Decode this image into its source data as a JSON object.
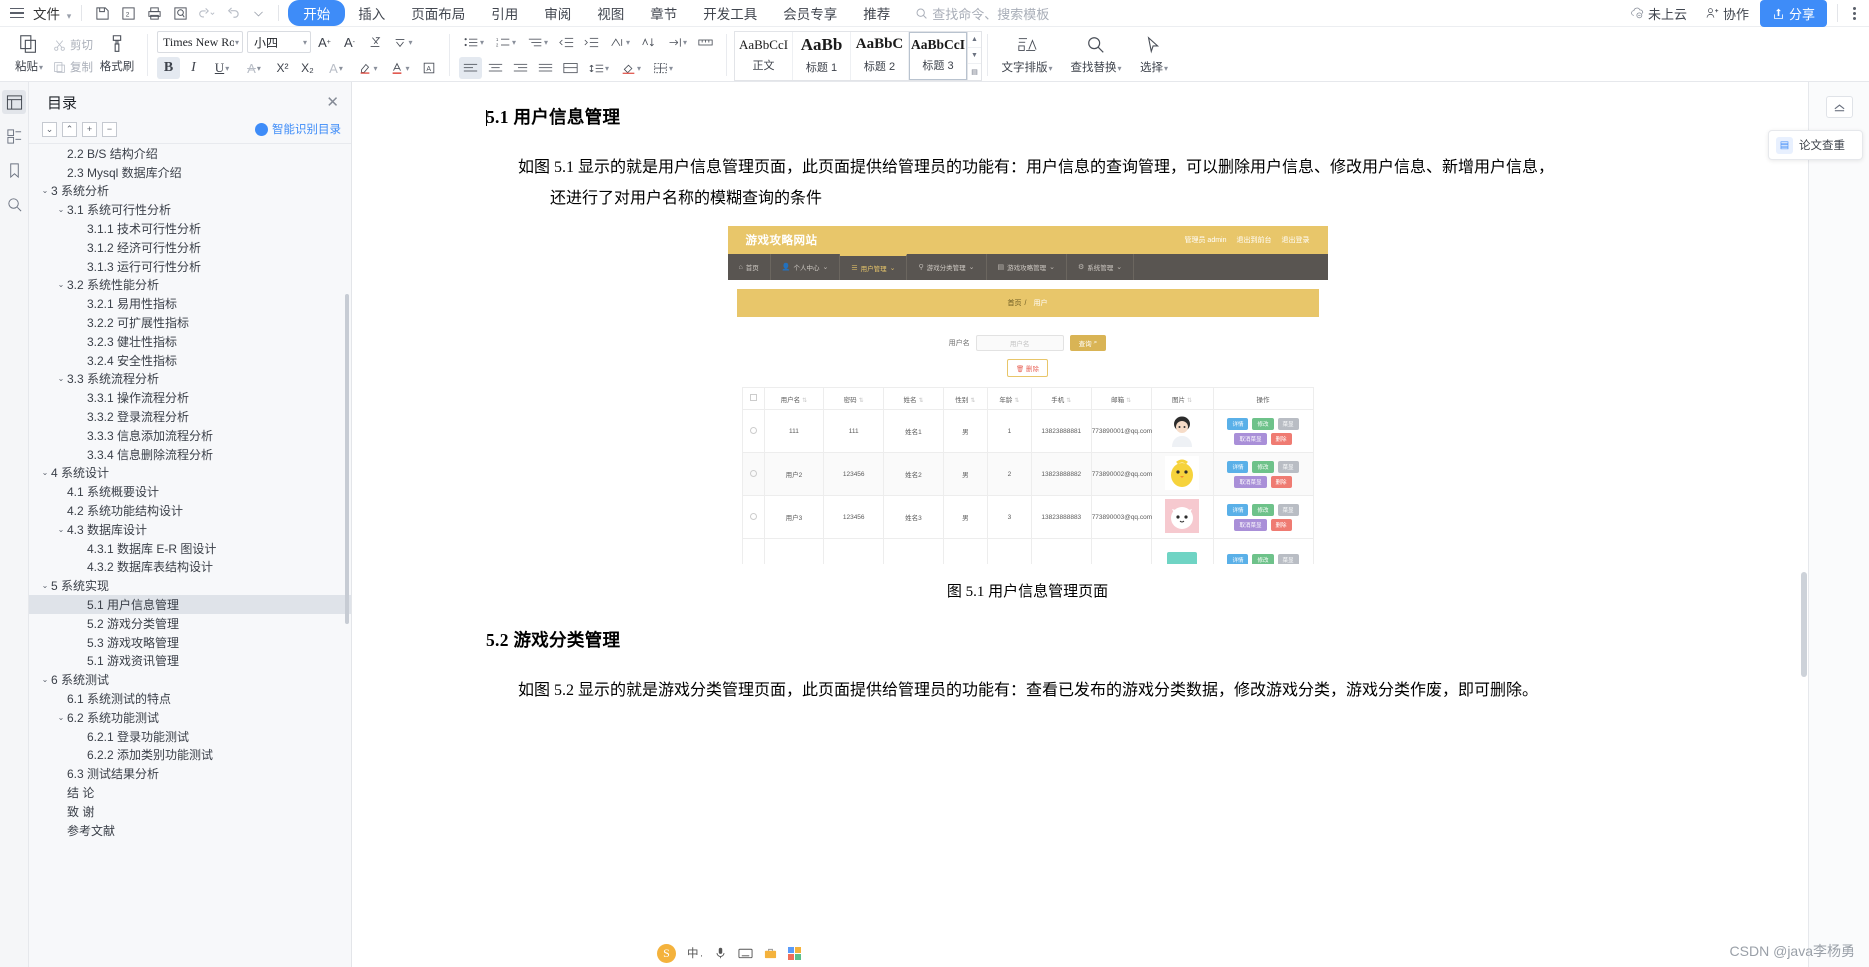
{
  "menubar": {
    "file_label": "文件",
    "quick_icons": [
      "save-icon",
      "save-as-icon",
      "print-icon",
      "print-preview-icon",
      "undo-icon",
      "redo-icon",
      "customize-icon"
    ],
    "tabs": [
      {
        "label": "开始",
        "active": true
      },
      {
        "label": "插入",
        "active": false
      },
      {
        "label": "页面布局",
        "active": false
      },
      {
        "label": "引用",
        "active": false
      },
      {
        "label": "审阅",
        "active": false
      },
      {
        "label": "视图",
        "active": false
      },
      {
        "label": "章节",
        "active": false
      },
      {
        "label": "开发工具",
        "active": false
      },
      {
        "label": "会员专享",
        "active": false
      },
      {
        "label": "推荐",
        "active": false
      }
    ],
    "search_placeholder": "查找命令、搜索模板",
    "cloud_label": "未上云",
    "collab_label": "协作",
    "share_label": "分享"
  },
  "ribbon": {
    "paste_label": "粘贴",
    "cut_label": "剪切",
    "copy_label": "复制",
    "format_painter_label": "格式刷",
    "font_name": "Times New Roma",
    "font_size": "小四",
    "grow_font": "A",
    "shrink_font": "A",
    "bold": "B",
    "italic": "I",
    "underline": "U",
    "strikethrough": "A",
    "superscript": "X²",
    "subscript": "X₂",
    "styles": [
      {
        "sample": "AaBbCcI",
        "name": "正文",
        "selected": false
      },
      {
        "sample": "AaBb",
        "name": "标题 1",
        "selected": false
      },
      {
        "sample": "AaBbC",
        "name": "标题 2",
        "selected": false
      },
      {
        "sample": "AaBbCcI",
        "name": "标题 3",
        "selected": true
      }
    ],
    "text_layout_label": "文字排版",
    "find_replace_label": "查找替换",
    "select_label": "选择"
  },
  "outline": {
    "title": "目录",
    "smart_label": "智能识别目录",
    "items": [
      {
        "label": "2.2 B/S 结构介绍",
        "level": 2,
        "arrow": "",
        "selected": false
      },
      {
        "label": "2.3 Mysql 数据库介绍",
        "level": 2,
        "arrow": "",
        "selected": false
      },
      {
        "label": "3  系统分析",
        "level": 1,
        "arrow": "v",
        "selected": false
      },
      {
        "label": "3.1  系统可行性分析",
        "level": 2,
        "arrow": "v",
        "selected": false
      },
      {
        "label": "3.1.1  技术可行性分析",
        "level": 3,
        "arrow": "",
        "selected": false
      },
      {
        "label": "3.1.2  经济可行性分析",
        "level": 3,
        "arrow": "",
        "selected": false
      },
      {
        "label": "3.1.3  运行可行性分析",
        "level": 3,
        "arrow": "",
        "selected": false
      },
      {
        "label": "3.2  系统性能分析",
        "level": 2,
        "arrow": "v",
        "selected": false
      },
      {
        "label": "3.2.1  易用性指标",
        "level": 3,
        "arrow": "",
        "selected": false
      },
      {
        "label": "3.2.2  可扩展性指标",
        "level": 3,
        "arrow": "",
        "selected": false
      },
      {
        "label": "3.2.3  健壮性指标",
        "level": 3,
        "arrow": "",
        "selected": false
      },
      {
        "label": "3.2.4  安全性指标",
        "level": 3,
        "arrow": "",
        "selected": false
      },
      {
        "label": "3.3  系统流程分析",
        "level": 2,
        "arrow": "v",
        "selected": false
      },
      {
        "label": "3.3.1  操作流程分析",
        "level": 3,
        "arrow": "",
        "selected": false
      },
      {
        "label": "3.3.2  登录流程分析",
        "level": 3,
        "arrow": "",
        "selected": false
      },
      {
        "label": "3.3.3  信息添加流程分析",
        "level": 3,
        "arrow": "",
        "selected": false
      },
      {
        "label": "3.3.4  信息删除流程分析",
        "level": 3,
        "arrow": "",
        "selected": false
      },
      {
        "label": "4  系统设计",
        "level": 1,
        "arrow": "v",
        "selected": false
      },
      {
        "label": "4.1  系统概要设计",
        "level": 2,
        "arrow": "",
        "selected": false
      },
      {
        "label": "4.2  系统功能结构设计",
        "level": 2,
        "arrow": "",
        "selected": false
      },
      {
        "label": "4.3  数据库设计",
        "level": 2,
        "arrow": "v",
        "selected": false
      },
      {
        "label": "4.3.1  数据库 E-R 图设计",
        "level": 3,
        "arrow": "",
        "selected": false
      },
      {
        "label": "4.3.2  数据库表结构设计",
        "level": 3,
        "arrow": "",
        "selected": false
      },
      {
        "label": "5  系统实现",
        "level": 1,
        "arrow": "v",
        "selected": false
      },
      {
        "label": "5.1 用户信息管理",
        "level": 3,
        "arrow": "",
        "selected": true
      },
      {
        "label": "5.2  游戏分类管理",
        "level": 3,
        "arrow": "",
        "selected": false
      },
      {
        "label": "5.3 游戏攻略管理",
        "level": 3,
        "arrow": "",
        "selected": false
      },
      {
        "label": "5.1 游戏资讯管理",
        "level": 3,
        "arrow": "",
        "selected": false
      },
      {
        "label": "6  系统测试",
        "level": 1,
        "arrow": "v",
        "selected": false
      },
      {
        "label": "6.1  系统测试的特点",
        "level": 2,
        "arrow": "",
        "selected": false
      },
      {
        "label": "6.2  系统功能测试",
        "level": 2,
        "arrow": "v",
        "selected": false
      },
      {
        "label": "6.2.1  登录功能测试",
        "level": 3,
        "arrow": "",
        "selected": false
      },
      {
        "label": "6.2.2  添加类别功能测试",
        "level": 3,
        "arrow": "",
        "selected": false
      },
      {
        "label": "6.3  测试结果分析",
        "level": 2,
        "arrow": "",
        "selected": false
      },
      {
        "label": "结   论",
        "level": 2,
        "arrow": "",
        "selected": false
      },
      {
        "label": "致   谢",
        "level": 2,
        "arrow": "",
        "selected": false
      },
      {
        "label": "参考文献",
        "level": 2,
        "arrow": "",
        "selected": false
      }
    ]
  },
  "document": {
    "heading1": "5.1 用户信息管理",
    "para1": "如图 5.1 显示的就是用户信息管理页面，此页面提供给管理员的功能有：用户信息的查询管理，可以删除用户信息、修改用户信息、新增用户信息，",
    "para1b": "还进行了对用户名称的模糊查询的条件",
    "figure_caption": "图 5.1  用户信息管理页面",
    "heading2": "5.2  游戏分类管理",
    "para2": "如图 5.2 显示的就是游戏分类管理页面，此页面提供给管理员的功能有：查看已发布的游戏分类数据，修改游戏分类，游戏分类作废，即可删除。"
  },
  "embedded_app": {
    "brand": "游戏攻略网站",
    "admin_text": "管理员 admin",
    "logout_admin": "退出到前台",
    "logout": "退出登录",
    "nav": [
      {
        "label": "首页",
        "icon": "home-icon",
        "active": false,
        "caret": false
      },
      {
        "label": "个人中心",
        "icon": "user-icon",
        "active": false,
        "caret": true
      },
      {
        "label": "用户管理",
        "icon": "list-icon",
        "active": true,
        "caret": true
      },
      {
        "label": "游戏分类管理",
        "icon": "tag-icon",
        "active": false,
        "caret": true
      },
      {
        "label": "游戏攻略管理",
        "icon": "book-icon",
        "active": false,
        "caret": true
      },
      {
        "label": "系统管理",
        "icon": "gear-icon",
        "active": false,
        "caret": true
      }
    ],
    "breadcrumb_home": "首页",
    "breadcrumb_sep": "/",
    "breadcrumb_current": "用户",
    "search_label": "用户名",
    "search_placeholder": "用户名",
    "search_button": "查询",
    "delete_button": "删除",
    "columns": [
      "用户名",
      "密码",
      "姓名",
      "性别",
      "年龄",
      "手机",
      "邮箱",
      "图片",
      "操作"
    ],
    "rows": [
      {
        "username": "111",
        "password": "111",
        "name": "姓名1",
        "gender": "男",
        "age": "1",
        "phone": "13823888881",
        "email": "773890001@qq.com",
        "avatar": "avatar-boy"
      },
      {
        "username": "用户2",
        "password": "123456",
        "name": "姓名2",
        "gender": "男",
        "age": "2",
        "phone": "13823888882",
        "email": "773890002@qq.com",
        "avatar": "avatar-chick"
      },
      {
        "username": "用户3",
        "password": "123456",
        "name": "姓名3",
        "gender": "男",
        "age": "3",
        "phone": "13823888883",
        "email": "773890003@qq.com",
        "avatar": "avatar-cat"
      }
    ],
    "row_actions": [
      {
        "label": "详情",
        "color": "blue"
      },
      {
        "label": "修改",
        "color": "green"
      },
      {
        "label": "菜显",
        "color": "gray"
      },
      {
        "label": "取消菜显",
        "color": "purple"
      },
      {
        "label": "删除",
        "color": "red"
      }
    ]
  },
  "right_panel": {
    "thesis_check_label": "论文查重"
  },
  "ime": {
    "logo": "S",
    "mode": "中",
    "watermark": "CSDN @java李杨勇"
  },
  "colors": {
    "accent_blue": "#3e8cf8",
    "app_gold": "#e8c66a",
    "app_dark": "#595551",
    "selection_gray": "#dfe3e9"
  }
}
